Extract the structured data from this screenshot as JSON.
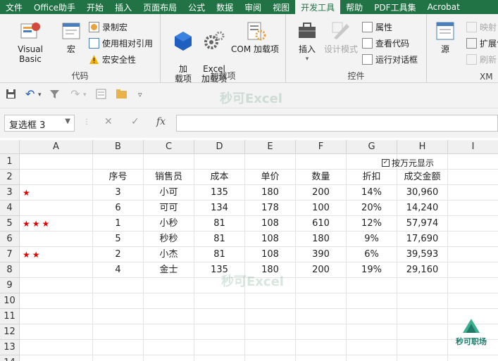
{
  "tabs": [
    "文件",
    "Office助手",
    "开始",
    "插入",
    "页面布局",
    "公式",
    "数据",
    "审阅",
    "视图",
    "开发工具",
    "帮助",
    "PDF工具集",
    "Acrobat"
  ],
  "active_tab_index": 9,
  "ribbon": {
    "code": {
      "label": "代码",
      "visual_basic": "Visual Basic",
      "macros": "宏",
      "record_macro": "录制宏",
      "relative_ref": "使用相对引用",
      "macro_security": "宏安全性"
    },
    "addins": {
      "label": "加载项",
      "addins": "加\n载项",
      "excel_addins": "Excel\n加载项",
      "com_addins": "COM 加载项"
    },
    "controls": {
      "label": "控件",
      "insert": "插入",
      "design_mode": "设计模式",
      "properties": "属性",
      "view_code": "查看代码",
      "run_dialog": "运行对话框"
    },
    "xml": {
      "label": "XM",
      "source": "源",
      "map_props": "映射",
      "expansion": "扩展包",
      "refresh": "刷新"
    }
  },
  "watermark": "秒可Excel",
  "formula_bar": {
    "name_box": "复选框 3",
    "cancel": "✕",
    "enter": "✓",
    "fx": "fx",
    "value": ""
  },
  "columns": [
    "A",
    "B",
    "C",
    "D",
    "E",
    "F",
    "G",
    "H",
    "I"
  ],
  "rows": [
    "1",
    "2",
    "3",
    "4",
    "5",
    "6",
    "7",
    "8",
    "9",
    "10",
    "11",
    "12",
    "13",
    "14"
  ],
  "checkbox_label": "按万元显示",
  "table": {
    "headers": [
      "序号",
      "销售员",
      "成本",
      "单价",
      "数量",
      "折扣",
      "成交金额"
    ],
    "rows": [
      {
        "stars": "★",
        "cells": [
          "3",
          "小可",
          "135",
          "180",
          "200",
          "14%",
          "30,960"
        ]
      },
      {
        "stars": "",
        "cells": [
          "6",
          "可可",
          "134",
          "178",
          "100",
          "20%",
          "14,240"
        ]
      },
      {
        "stars": "★★★",
        "cells": [
          "1",
          "小秒",
          "81",
          "108",
          "610",
          "12%",
          "57,974"
        ]
      },
      {
        "stars": "",
        "cells": [
          "5",
          "秒秒",
          "81",
          "108",
          "180",
          "9%",
          "17,690"
        ]
      },
      {
        "stars": "★★",
        "cells": [
          "2",
          "小杰",
          "81",
          "108",
          "390",
          "6%",
          "39,593"
        ]
      },
      {
        "stars": "",
        "cells": [
          "4",
          "金士",
          "135",
          "180",
          "200",
          "19%",
          "29,160"
        ]
      }
    ]
  },
  "logo_text": "秒可职场",
  "colors": {
    "accent": "#217346",
    "star": "#e00000"
  }
}
